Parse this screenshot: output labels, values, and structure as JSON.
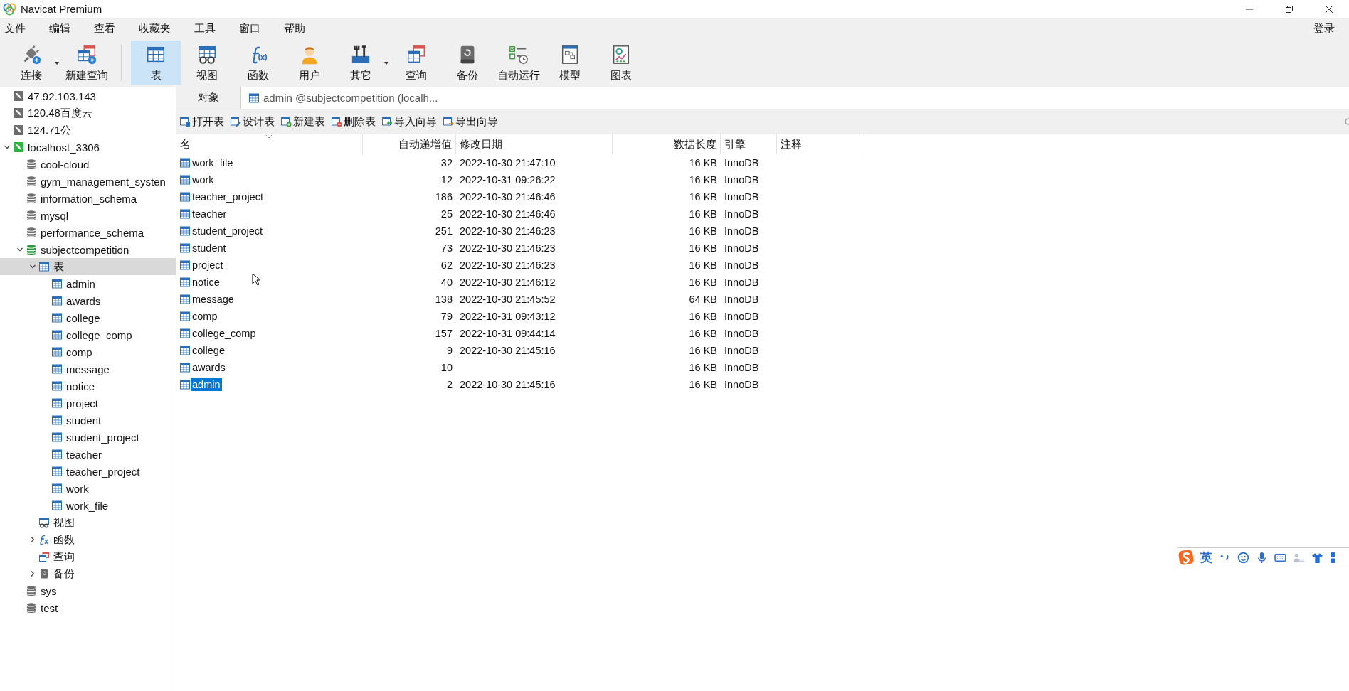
{
  "window": {
    "title": "Navicat Premium"
  },
  "menu": [
    "文件",
    "编辑",
    "查看",
    "收藏夹",
    "工具",
    "窗口",
    "帮助"
  ],
  "login": "登录",
  "toolbar": [
    {
      "kind": "connect",
      "label": "连接",
      "dropdown": true,
      "selected": false
    },
    {
      "kind": "newquery",
      "label": "新建查询",
      "dropdown": false,
      "selected": false
    },
    {
      "kind": "table",
      "label": "表",
      "dropdown": false,
      "selected": true
    },
    {
      "kind": "view",
      "label": "视图",
      "dropdown": false,
      "selected": false
    },
    {
      "kind": "function",
      "label": "函数",
      "dropdown": false,
      "selected": false
    },
    {
      "kind": "user",
      "label": "用户",
      "dropdown": false,
      "selected": false
    },
    {
      "kind": "other",
      "label": "其它",
      "dropdown": true,
      "selected": false
    },
    {
      "kind": "query",
      "label": "查询",
      "dropdown": false,
      "selected": false
    },
    {
      "kind": "backup",
      "label": "备份",
      "dropdown": false,
      "selected": false
    },
    {
      "kind": "autorun",
      "label": "自动运行",
      "dropdown": false,
      "selected": false
    },
    {
      "kind": "model",
      "label": "模型",
      "dropdown": false,
      "selected": false
    },
    {
      "kind": "chart",
      "label": "图表",
      "dropdown": false,
      "selected": false
    }
  ],
  "sidebar": {
    "tree": [
      {
        "kind": "server",
        "label": "47.92.103.143",
        "connected": false,
        "selected": false
      },
      {
        "kind": "server",
        "label": "120.48百度云",
        "connected": false,
        "selected": false
      },
      {
        "kind": "server",
        "label": "124.71公",
        "connected": false,
        "selected": false
      },
      {
        "kind": "server",
        "label": "localhost_3306",
        "connected": true,
        "expanded": true,
        "selected": false,
        "children": [
          {
            "kind": "database",
            "label": "cool-cloud",
            "connected": false,
            "selected": false
          },
          {
            "kind": "database",
            "label": "gym_management_systen",
            "connected": false,
            "selected": false
          },
          {
            "kind": "database",
            "label": "information_schema",
            "connected": false,
            "selected": false
          },
          {
            "kind": "database",
            "label": "mysql",
            "connected": false,
            "selected": false
          },
          {
            "kind": "database",
            "label": "performance_schema",
            "connected": false,
            "selected": false
          },
          {
            "kind": "database",
            "label": "subjectcompetition",
            "connected": true,
            "expanded": true,
            "selected": false,
            "children": [
              {
                "kind": "tables",
                "label": "表",
                "expanded": true,
                "selected": true,
                "children": [
                  {
                    "kind": "table",
                    "label": "admin",
                    "selected": false
                  },
                  {
                    "kind": "table",
                    "label": "awards",
                    "selected": false
                  },
                  {
                    "kind": "table",
                    "label": "college",
                    "selected": false
                  },
                  {
                    "kind": "table",
                    "label": "college_comp",
                    "selected": false
                  },
                  {
                    "kind": "table",
                    "label": "comp",
                    "selected": false
                  },
                  {
                    "kind": "table",
                    "label": "message",
                    "selected": false
                  },
                  {
                    "kind": "table",
                    "label": "notice",
                    "selected": false
                  },
                  {
                    "kind": "table",
                    "label": "project",
                    "selected": false
                  },
                  {
                    "kind": "table",
                    "label": "student",
                    "selected": false
                  },
                  {
                    "kind": "table",
                    "label": "student_project",
                    "selected": false
                  },
                  {
                    "kind": "table",
                    "label": "teacher",
                    "selected": false
                  },
                  {
                    "kind": "table",
                    "label": "teacher_project",
                    "selected": false
                  },
                  {
                    "kind": "table",
                    "label": "work",
                    "selected": false
                  },
                  {
                    "kind": "table",
                    "label": "work_file",
                    "selected": false
                  }
                ]
              },
              {
                "kind": "views",
                "label": "视图",
                "selected": false
              },
              {
                "kind": "functions",
                "label": "函数",
                "expandable": true,
                "selected": false
              },
              {
                "kind": "queries",
                "label": "查询",
                "selected": false
              },
              {
                "kind": "backups",
                "label": "备份",
                "expandable": true,
                "selected": false
              }
            ]
          },
          {
            "kind": "database",
            "label": "sys",
            "connected": false,
            "selected": false
          },
          {
            "kind": "database",
            "label": "test",
            "connected": false,
            "selected": false
          }
        ]
      }
    ]
  },
  "tabs": [
    {
      "kind": "objects",
      "label": "对象",
      "selected": true
    },
    {
      "kind": "table",
      "label": "admin @subjectcompetition (localh...",
      "selected": false
    }
  ],
  "object_toolbar": [
    {
      "kind": "open",
      "label": "打开表"
    },
    {
      "kind": "design",
      "label": "设计表"
    },
    {
      "kind": "new",
      "label": "新建表"
    },
    {
      "kind": "delete",
      "label": "删除表"
    },
    {
      "kind": "import",
      "label": "导入向导"
    },
    {
      "kind": "export",
      "label": "导出向导"
    }
  ],
  "table": {
    "columns": [
      "名",
      "自动递增值",
      "修改日期",
      "数据长度",
      "引擎",
      "注释"
    ],
    "rows": [
      {
        "name": "work_file",
        "auto_increment": "32",
        "modified": "2022-10-30 21:47:10",
        "data_length": "16 KB",
        "engine": "InnoDB",
        "selected": false
      },
      {
        "name": "work",
        "auto_increment": "12",
        "modified": "2022-10-31 09:26:22",
        "data_length": "16 KB",
        "engine": "InnoDB",
        "selected": false
      },
      {
        "name": "teacher_project",
        "auto_increment": "186",
        "modified": "2022-10-30 21:46:46",
        "data_length": "16 KB",
        "engine": "InnoDB",
        "selected": false
      },
      {
        "name": "teacher",
        "auto_increment": "25",
        "modified": "2022-10-30 21:46:46",
        "data_length": "16 KB",
        "engine": "InnoDB",
        "selected": false
      },
      {
        "name": "student_project",
        "auto_increment": "251",
        "modified": "2022-10-30 21:46:23",
        "data_length": "16 KB",
        "engine": "InnoDB",
        "selected": false
      },
      {
        "name": "student",
        "auto_increment": "73",
        "modified": "2022-10-30 21:46:23",
        "data_length": "16 KB",
        "engine": "InnoDB",
        "selected": false
      },
      {
        "name": "project",
        "auto_increment": "62",
        "modified": "2022-10-30 21:46:23",
        "data_length": "16 KB",
        "engine": "InnoDB",
        "selected": false
      },
      {
        "name": "notice",
        "auto_increment": "40",
        "modified": "2022-10-30 21:46:12",
        "data_length": "16 KB",
        "engine": "InnoDB",
        "selected": false
      },
      {
        "name": "message",
        "auto_increment": "138",
        "modified": "2022-10-30 21:45:52",
        "data_length": "64 KB",
        "engine": "InnoDB",
        "selected": false
      },
      {
        "name": "comp",
        "auto_increment": "79",
        "modified": "2022-10-31 09:43:12",
        "data_length": "16 KB",
        "engine": "InnoDB",
        "selected": false
      },
      {
        "name": "college_comp",
        "auto_increment": "157",
        "modified": "2022-10-31 09:44:14",
        "data_length": "16 KB",
        "engine": "InnoDB",
        "selected": false
      },
      {
        "name": "college",
        "auto_increment": "9",
        "modified": "2022-10-30 21:45:16",
        "data_length": "16 KB",
        "engine": "InnoDB",
        "selected": false
      },
      {
        "name": "awards",
        "auto_increment": "10",
        "data_length": "16 KB",
        "engine": "InnoDB",
        "selected": false
      },
      {
        "name": "admin",
        "auto_increment": "2",
        "modified": "2022-10-30 21:45:16",
        "data_length": "16 KB",
        "engine": "InnoDB",
        "selected": true
      }
    ]
  },
  "ime_bar": {
    "mode": "英"
  }
}
